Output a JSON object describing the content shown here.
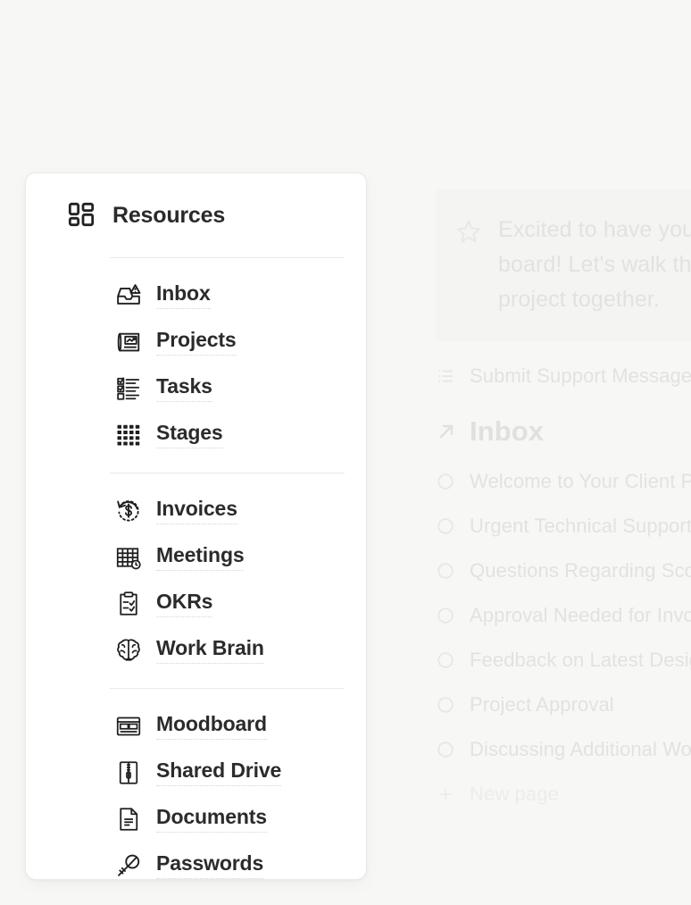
{
  "background_page": {
    "callout": {
      "icon": "star-icon",
      "text": "Excited to have you on board! Let's walk through our project together."
    },
    "rows": [
      {
        "icon": "list-icon",
        "label": "Submit Support Message"
      }
    ],
    "section": {
      "icon": "arrow-up-right-icon",
      "title": "Inbox"
    },
    "inbox_items": [
      {
        "icon": "circle-icon",
        "label": "Welcome to Your Client Portal"
      },
      {
        "icon": "circle-icon",
        "label": "Urgent Technical Support Request"
      },
      {
        "icon": "circle-icon",
        "label": "Questions Regarding Scope"
      },
      {
        "icon": "circle-icon",
        "label": "Approval Needed for Invoice"
      },
      {
        "icon": "circle-icon",
        "label": "Feedback on Latest Designs"
      },
      {
        "icon": "circle-icon",
        "label": "Project Approval"
      },
      {
        "icon": "circle-icon",
        "label": "Discussing Additional Work"
      }
    ],
    "new_page": {
      "icon": "plus-icon",
      "label": "New page"
    }
  },
  "panel": {
    "header": {
      "icon": "dashboard-grid-icon",
      "title": "Resources"
    },
    "groups": [
      {
        "items": [
          {
            "icon": "inbox-tray-icon",
            "label": "Inbox"
          },
          {
            "icon": "blueprint-chart-icon",
            "label": "Projects"
          },
          {
            "icon": "checklist-icon",
            "label": "Tasks"
          },
          {
            "icon": "dot-grid-icon",
            "label": "Stages"
          }
        ]
      },
      {
        "items": [
          {
            "icon": "dollar-refresh-icon",
            "label": "Invoices"
          },
          {
            "icon": "calendar-table-clock-icon",
            "label": "Meetings"
          },
          {
            "icon": "clipboard-check-icon",
            "label": "OKRs"
          },
          {
            "icon": "brain-icon",
            "label": "Work Brain"
          }
        ]
      },
      {
        "items": [
          {
            "icon": "layout-cards-icon",
            "label": "Moodboard"
          },
          {
            "icon": "zip-drive-icon",
            "label": "Shared Drive"
          },
          {
            "icon": "document-icon",
            "label": "Documents"
          },
          {
            "icon": "key-icon",
            "label": "Passwords"
          }
        ]
      }
    ]
  },
  "colors": {
    "app_background": "#f7f7f6",
    "panel_background": "#ffffff",
    "panel_border": "#e9e9e7",
    "text_primary": "#2b2b2b",
    "underline": "#d4d4d2",
    "faded_text": "#e2e2e0"
  }
}
